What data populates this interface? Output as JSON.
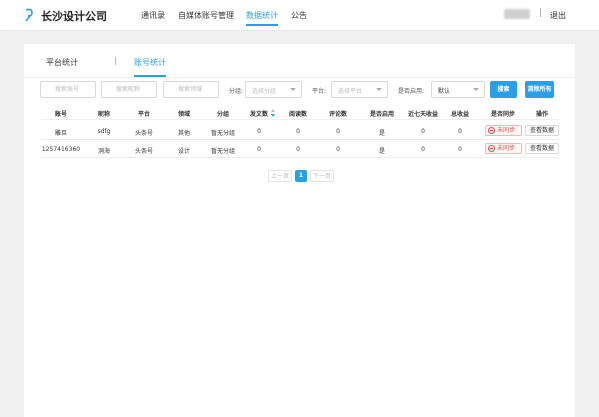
{
  "header": {
    "company": "长沙设计公司",
    "nav": [
      "通讯录",
      "自媒体账号管理",
      "数据统计",
      "公告"
    ],
    "active_nav": "数据统计",
    "logout": "退出",
    "separator": "|"
  },
  "tabs": {
    "items": [
      "平台统计",
      "账号统计"
    ],
    "active": "账号统计",
    "separator": "|"
  },
  "filters": {
    "search_account_placeholder": "搜索账号",
    "search_nickname_placeholder": "搜索昵称",
    "search_field_placeholder": "搜索领域",
    "group_label": "分组:",
    "group_placeholder": "选择分组",
    "platform_label": "平台:",
    "platform_placeholder": "选择平台",
    "enabled_label": "是否启用:",
    "enabled_value": "默认",
    "search_button": "搜索",
    "clear_button": "清除所有"
  },
  "table": {
    "columns": [
      "账号",
      "昵称",
      "平台",
      "领域",
      "分组",
      "发文数",
      "阅读数",
      "评论数",
      "是否启用",
      "近七天收益",
      "总收益",
      "是否同步",
      "操作"
    ],
    "rows": [
      {
        "account": "雕旦",
        "nickname": "sdfg",
        "platform": "头条号",
        "field": "其他",
        "group": "暂无分组",
        "posts": "0",
        "reads": "0",
        "comments": "0",
        "enabled": "是",
        "week_income": "0",
        "total_income": "0",
        "sync": "未同步",
        "action": "查看数据"
      },
      {
        "account": "1257416360",
        "nickname": "洞海",
        "platform": "头条号",
        "field": "设计",
        "group": "暂无分组",
        "posts": "0",
        "reads": "0",
        "comments": "0",
        "enabled": "是",
        "week_income": "0",
        "total_income": "0",
        "sync": "未同步",
        "action": "查看数据"
      }
    ]
  },
  "pagination": {
    "prev": "上一页",
    "current": "1",
    "next": "下一页"
  },
  "colors": {
    "accent": "#29a0e6",
    "danger": "#d9534f"
  },
  "icons": {
    "logo": "logo-icon",
    "search": "search-icon",
    "sort": "sort-icon",
    "not_synced": "minus-circle-icon",
    "dropdown": "chevron-down-icon"
  }
}
